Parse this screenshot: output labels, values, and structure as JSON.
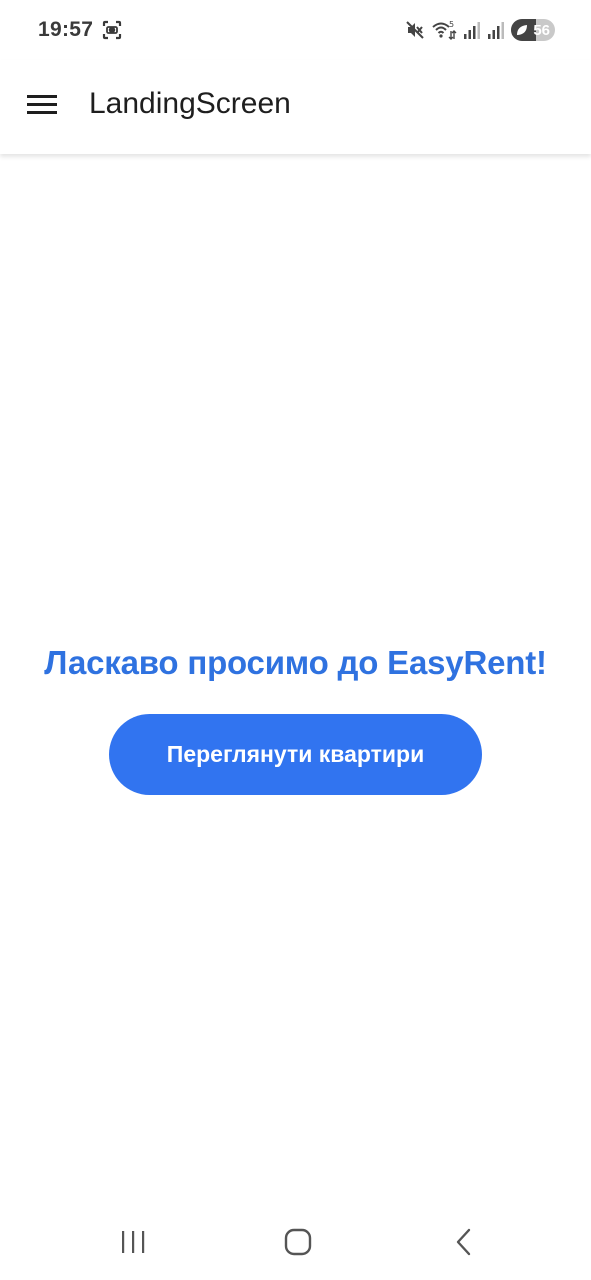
{
  "status_bar": {
    "time": "19:57",
    "battery_level": "56",
    "icons": [
      "screenshot-icon",
      "mute-icon",
      "wifi-icon",
      "signal-icon",
      "signal-icon-2",
      "battery-icon"
    ]
  },
  "app_bar": {
    "title": "LandingScreen",
    "menu_icon": "menu-icon"
  },
  "main": {
    "welcome_text": "Ласкаво просимо до EasyRent!",
    "view_apartments_label": "Переглянути квартири"
  },
  "nav_bar": {
    "icons": [
      "recent-apps-icon",
      "home-icon",
      "back-icon"
    ]
  },
  "colors": {
    "accent": "#3174f0",
    "welcome_text": "#2f72e0",
    "background": "#ffffff"
  }
}
